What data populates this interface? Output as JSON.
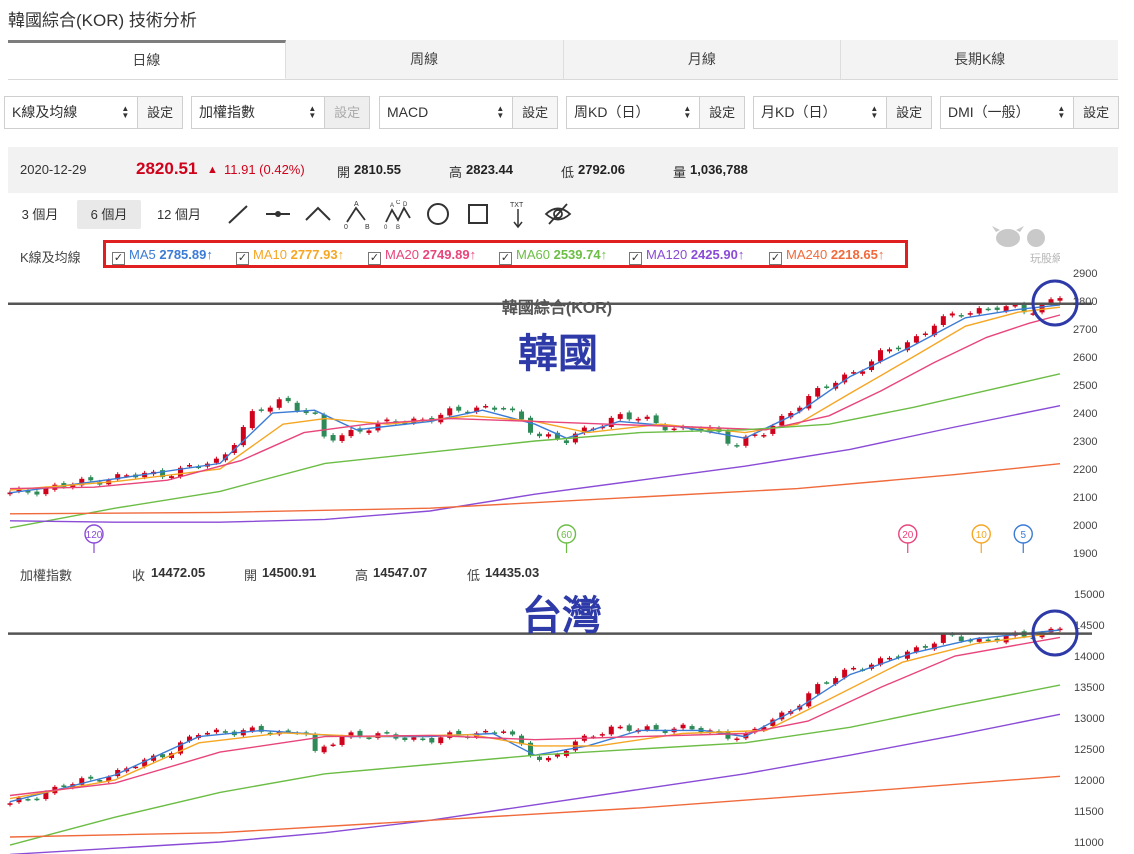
{
  "page": {
    "title": "韓國綜合(KOR) 技術分析"
  },
  "tabs": [
    {
      "label": "日線",
      "active": true
    },
    {
      "label": "周線",
      "active": false
    },
    {
      "label": "月線",
      "active": false
    },
    {
      "label": "長期K線",
      "active": false
    }
  ],
  "toolbar": {
    "selects": [
      {
        "value": "K線及均線",
        "button": "設定",
        "disabled": false
      },
      {
        "value": "加權指數",
        "button": "設定",
        "disabled": true
      },
      {
        "value": "MACD",
        "button": "設定",
        "disabled": false
      },
      {
        "value": "周KD（日）",
        "button": "設定",
        "disabled": false
      },
      {
        "value": "月KD（日）",
        "button": "設定",
        "disabled": false
      },
      {
        "value": "DMI（一般）",
        "button": "設定",
        "disabled": false
      }
    ]
  },
  "quote": {
    "date": "2020-12-29",
    "price": "2820.51",
    "change": "11.91 (0.42%)",
    "open_label": "開",
    "open": "2810.55",
    "high_label": "高",
    "high": "2823.44",
    "low_label": "低",
    "low": "2792.06",
    "volume_label": "量",
    "volume": "1,036,788"
  },
  "ranges": [
    {
      "label": "3 個月",
      "active": false
    },
    {
      "label": "6 個月",
      "active": true
    },
    {
      "label": "12 個月",
      "active": false
    }
  ],
  "tools": [
    "line-tool-icon",
    "segment-tool-icon",
    "peak-tool-icon",
    "abc-pattern-icon",
    "abcd-pattern-icon",
    "circle-tool-icon",
    "rectangle-tool-icon",
    "text-tool-icon",
    "hide-eye-icon"
  ],
  "ma_legend": {
    "label": "K線及均線",
    "items": [
      {
        "name": "MA5",
        "value": "2785.89↑",
        "color": "#3a7bd5"
      },
      {
        "name": "MA10",
        "value": "2777.93↑",
        "color": "#f5a623"
      },
      {
        "name": "MA20",
        "value": "2749.89↑",
        "color": "#e8457a"
      },
      {
        "name": "MA60",
        "value": "2539.74↑",
        "color": "#6cbd45"
      },
      {
        "name": "MA120",
        "value": "2425.90↑",
        "color": "#8a4bd6"
      },
      {
        "name": "MA240",
        "value": "2218.65↑",
        "color": "#f06a3c"
      }
    ]
  },
  "logo": {
    "text": "玩股網"
  },
  "colors": {
    "up": "#d0021b",
    "down": "#2e8b57",
    "accent_red": "#e02020",
    "annotation_blue": "#2d3aa8"
  },
  "taiwan_header": {
    "name": "加權指數",
    "close_label": "收",
    "close": "14472.05",
    "open_label": "開",
    "open": "14500.91",
    "high_label": "高",
    "high": "14547.07",
    "low_label": "低",
    "low": "14435.03"
  },
  "chart_data": [
    {
      "type": "candlestick",
      "title": "韓國綜合(KOR)",
      "annotation": "韓國",
      "ylim": [
        1900,
        2900
      ],
      "yticks": [
        1900,
        2000,
        2100,
        2200,
        2300,
        2400,
        2500,
        2600,
        2700,
        2800,
        2900
      ],
      "reference_line": 2790,
      "ma_markers": [
        {
          "label": "120",
          "x": 0.08
        },
        {
          "label": "60",
          "x": 0.53
        },
        {
          "label": "20",
          "x": 0.855
        },
        {
          "label": "10",
          "x": 0.925
        },
        {
          "label": "5",
          "x": 0.965
        }
      ],
      "close_path": [
        [
          0,
          2110
        ],
        [
          0.05,
          2140
        ],
        [
          0.1,
          2170
        ],
        [
          0.15,
          2185
        ],
        [
          0.2,
          2230
        ],
        [
          0.23,
          2390
        ],
        [
          0.26,
          2450
        ],
        [
          0.29,
          2390
        ],
        [
          0.3,
          2300
        ],
        [
          0.33,
          2340
        ],
        [
          0.37,
          2370
        ],
        [
          0.4,
          2380
        ],
        [
          0.44,
          2420
        ],
        [
          0.47,
          2420
        ],
        [
          0.5,
          2330
        ],
        [
          0.53,
          2300
        ],
        [
          0.56,
          2360
        ],
        [
          0.58,
          2390
        ],
        [
          0.61,
          2370
        ],
        [
          0.64,
          2340
        ],
        [
          0.67,
          2340
        ],
        [
          0.69,
          2290
        ],
        [
          0.72,
          2330
        ],
        [
          0.75,
          2430
        ],
        [
          0.78,
          2500
        ],
        [
          0.81,
          2560
        ],
        [
          0.83,
          2610
        ],
        [
          0.86,
          2660
        ],
        [
          0.88,
          2720
        ],
        [
          0.91,
          2760
        ],
        [
          0.94,
          2780
        ],
        [
          0.97,
          2760
        ],
        [
          1.0,
          2820
        ]
      ],
      "ma": {
        "MA5": [
          [
            0,
            2115
          ],
          [
            0.1,
            2165
          ],
          [
            0.2,
            2220
          ],
          [
            0.25,
            2400
          ],
          [
            0.29,
            2410
          ],
          [
            0.33,
            2340
          ],
          [
            0.4,
            2370
          ],
          [
            0.45,
            2410
          ],
          [
            0.5,
            2360
          ],
          [
            0.53,
            2310
          ],
          [
            0.58,
            2370
          ],
          [
            0.64,
            2350
          ],
          [
            0.7,
            2310
          ],
          [
            0.75,
            2400
          ],
          [
            0.8,
            2530
          ],
          [
            0.86,
            2640
          ],
          [
            0.91,
            2740
          ],
          [
            0.96,
            2770
          ],
          [
            1.0,
            2786
          ]
        ],
        "MA10": [
          [
            0,
            2125
          ],
          [
            0.1,
            2155
          ],
          [
            0.2,
            2200
          ],
          [
            0.26,
            2360
          ],
          [
            0.3,
            2380
          ],
          [
            0.36,
            2360
          ],
          [
            0.44,
            2390
          ],
          [
            0.5,
            2370
          ],
          [
            0.55,
            2330
          ],
          [
            0.62,
            2360
          ],
          [
            0.7,
            2330
          ],
          [
            0.75,
            2360
          ],
          [
            0.8,
            2470
          ],
          [
            0.86,
            2600
          ],
          [
            0.91,
            2710
          ],
          [
            0.96,
            2760
          ],
          [
            1.0,
            2778
          ]
        ],
        "MA20": [
          [
            0,
            2130
          ],
          [
            0.08,
            2135
          ],
          [
            0.15,
            2160
          ],
          [
            0.22,
            2230
          ],
          [
            0.28,
            2330
          ],
          [
            0.34,
            2360
          ],
          [
            0.42,
            2380
          ],
          [
            0.5,
            2370
          ],
          [
            0.57,
            2360
          ],
          [
            0.65,
            2350
          ],
          [
            0.72,
            2340
          ],
          [
            0.78,
            2390
          ],
          [
            0.83,
            2480
          ],
          [
            0.88,
            2580
          ],
          [
            0.93,
            2670
          ],
          [
            0.97,
            2720
          ],
          [
            1.0,
            2750
          ]
        ],
        "MA60": [
          [
            0,
            1990
          ],
          [
            0.1,
            2060
          ],
          [
            0.2,
            2120
          ],
          [
            0.3,
            2220
          ],
          [
            0.4,
            2260
          ],
          [
            0.5,
            2300
          ],
          [
            0.6,
            2330
          ],
          [
            0.7,
            2340
          ],
          [
            0.78,
            2360
          ],
          [
            0.86,
            2420
          ],
          [
            0.93,
            2480
          ],
          [
            1.0,
            2540
          ]
        ],
        "MA120": [
          [
            0,
            2015
          ],
          [
            0.1,
            2010
          ],
          [
            0.2,
            2010
          ],
          [
            0.3,
            2020
          ],
          [
            0.4,
            2050
          ],
          [
            0.5,
            2110
          ],
          [
            0.6,
            2160
          ],
          [
            0.7,
            2210
          ],
          [
            0.8,
            2270
          ],
          [
            0.9,
            2350
          ],
          [
            1.0,
            2426
          ]
        ],
        "MA240": [
          [
            0,
            2040
          ],
          [
            0.2,
            2045
          ],
          [
            0.4,
            2060
          ],
          [
            0.6,
            2100
          ],
          [
            0.75,
            2130
          ],
          [
            0.9,
            2180
          ],
          [
            1.0,
            2219
          ]
        ]
      }
    },
    {
      "type": "candlestick",
      "title": "加權指數",
      "annotation": "台灣",
      "ylim": [
        11000,
        15000
      ],
      "yticks": [
        11000,
        11500,
        12000,
        12500,
        13000,
        13500,
        14000,
        14500,
        15000
      ],
      "reference_line": 14360,
      "close_path": [
        [
          0,
          11600
        ],
        [
          0.05,
          11900
        ],
        [
          0.1,
          12100
        ],
        [
          0.15,
          12450
        ],
        [
          0.18,
          12750
        ],
        [
          0.22,
          12800
        ],
        [
          0.26,
          12750
        ],
        [
          0.28,
          12850
        ],
        [
          0.29,
          12400
        ],
        [
          0.32,
          12750
        ],
        [
          0.36,
          12700
        ],
        [
          0.4,
          12650
        ],
        [
          0.44,
          12750
        ],
        [
          0.47,
          12800
        ],
        [
          0.49,
          12500
        ],
        [
          0.51,
          12300
        ],
        [
          0.54,
          12600
        ],
        [
          0.57,
          12850
        ],
        [
          0.6,
          12800
        ],
        [
          0.64,
          12850
        ],
        [
          0.67,
          12750
        ],
        [
          0.7,
          12700
        ],
        [
          0.74,
          13100
        ],
        [
          0.77,
          13500
        ],
        [
          0.8,
          13800
        ],
        [
          0.83,
          13900
        ],
        [
          0.86,
          14100
        ],
        [
          0.89,
          14300
        ],
        [
          0.92,
          14250
        ],
        [
          0.95,
          14300
        ],
        [
          0.98,
          14350
        ],
        [
          1.0,
          14480
        ]
      ],
      "ma": {
        "MA5": [
          [
            0,
            11650
          ],
          [
            0.1,
            12080
          ],
          [
            0.18,
            12700
          ],
          [
            0.24,
            12800
          ],
          [
            0.28,
            12750
          ],
          [
            0.32,
            12700
          ],
          [
            0.4,
            12700
          ],
          [
            0.46,
            12750
          ],
          [
            0.5,
            12400
          ],
          [
            0.55,
            12550
          ],
          [
            0.6,
            12800
          ],
          [
            0.66,
            12800
          ],
          [
            0.7,
            12700
          ],
          [
            0.75,
            13150
          ],
          [
            0.8,
            13700
          ],
          [
            0.86,
            14050
          ],
          [
            0.92,
            14280
          ],
          [
            1.0,
            14420
          ]
        ],
        "MA10": [
          [
            0,
            11700
          ],
          [
            0.1,
            12000
          ],
          [
            0.18,
            12600
          ],
          [
            0.26,
            12760
          ],
          [
            0.34,
            12700
          ],
          [
            0.44,
            12730
          ],
          [
            0.5,
            12550
          ],
          [
            0.56,
            12550
          ],
          [
            0.64,
            12750
          ],
          [
            0.72,
            12800
          ],
          [
            0.78,
            13300
          ],
          [
            0.85,
            13900
          ],
          [
            0.92,
            14200
          ],
          [
            1.0,
            14380
          ]
        ],
        "MA20": [
          [
            0,
            11750
          ],
          [
            0.1,
            11950
          ],
          [
            0.2,
            12450
          ],
          [
            0.3,
            12700
          ],
          [
            0.4,
            12720
          ],
          [
            0.5,
            12650
          ],
          [
            0.6,
            12700
          ],
          [
            0.7,
            12750
          ],
          [
            0.76,
            12950
          ],
          [
            0.83,
            13500
          ],
          [
            0.9,
            14000
          ],
          [
            1.0,
            14300
          ]
        ],
        "MA60": [
          [
            0,
            10950
          ],
          [
            0.1,
            11400
          ],
          [
            0.2,
            11800
          ],
          [
            0.3,
            12100
          ],
          [
            0.4,
            12250
          ],
          [
            0.5,
            12400
          ],
          [
            0.6,
            12500
          ],
          [
            0.7,
            12600
          ],
          [
            0.8,
            12850
          ],
          [
            0.9,
            13200
          ],
          [
            1.0,
            13530
          ]
        ],
        "MA120": [
          [
            0,
            10800
          ],
          [
            0.1,
            10900
          ],
          [
            0.2,
            11000
          ],
          [
            0.3,
            11150
          ],
          [
            0.4,
            11350
          ],
          [
            0.5,
            11600
          ],
          [
            0.6,
            11850
          ],
          [
            0.7,
            12100
          ],
          [
            0.8,
            12400
          ],
          [
            0.9,
            12720
          ],
          [
            1.0,
            13060
          ]
        ],
        "MA240": [
          [
            0,
            11080
          ],
          [
            0.2,
            11150
          ],
          [
            0.4,
            11350
          ],
          [
            0.6,
            11550
          ],
          [
            0.8,
            11800
          ],
          [
            1.0,
            12060
          ]
        ]
      }
    }
  ]
}
